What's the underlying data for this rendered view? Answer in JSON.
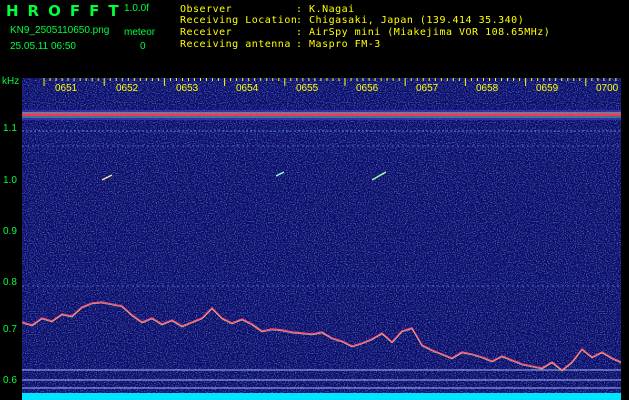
{
  "header": {
    "brand": "HROFFT",
    "version": "1.0.0f",
    "filename": "KN9_2505110650.png",
    "mode_label": "meteor",
    "datetime": "25.05.11 06:50",
    "count": "0",
    "info_labels": [
      "Observer",
      "Receiving Location",
      "Receiver",
      "Receiving antenna"
    ],
    "info_values": [
      ": K.Nagai",
      ": Chigasaki, Japan (139.414 35.340)",
      ": AirSpy mini (Miakejima VOR 108.65MHz)",
      ": Maspro FM-3"
    ]
  },
  "spectrogram": {
    "unit_label": "kHz",
    "time_labels": [
      "0651",
      "0652",
      "0653",
      "0654",
      "0655",
      "0656",
      "0657",
      "0658",
      "0659",
      "0700"
    ],
    "freq_labels": [
      "1.1",
      "1.0",
      "0.9",
      "0.8",
      "0.7",
      "0.6"
    ],
    "colors": {
      "background": "#000000",
      "field": "#0a0a6a",
      "tick_yellow": "#ffff00",
      "label_green": "#00ff3c",
      "bottom_band": "#00e5ff",
      "carrier": "#ff3060"
    }
  }
}
